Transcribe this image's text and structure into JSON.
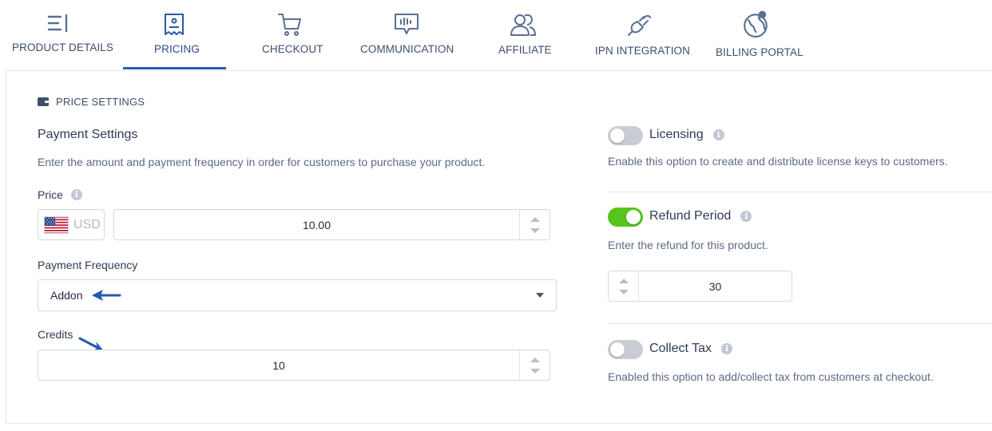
{
  "tabs": [
    {
      "label": "PRODUCT DETAILS",
      "icon": "list-icon"
    },
    {
      "label": "PRICING",
      "icon": "receipt-icon",
      "active": true
    },
    {
      "label": "CHECKOUT",
      "icon": "cart-icon"
    },
    {
      "label": "COMMUNICATION",
      "icon": "chat-icon"
    },
    {
      "label": "AFFILIATE",
      "icon": "users-icon"
    },
    {
      "label": "IPN INTEGRATION",
      "icon": "plug-icon"
    },
    {
      "label": "BILLING PORTAL",
      "icon": "globe-icon"
    }
  ],
  "section": {
    "title": "PRICE SETTINGS",
    "icon": "wallet-icon"
  },
  "payment": {
    "heading": "Payment Settings",
    "description": "Enter the amount and payment frequency in order for customers to purchase your product.",
    "price_label": "Price",
    "currency": "USD",
    "price_value": "10.00",
    "frequency_label": "Payment Frequency",
    "frequency_value": "Addon",
    "credits_label": "Credits",
    "credits_value": "10"
  },
  "licensing": {
    "label": "Licensing",
    "enabled": false,
    "description": "Enable this option to create and distribute license keys to customers."
  },
  "refund": {
    "label": "Refund Period",
    "enabled": true,
    "description": "Enter the refund for this product.",
    "value": "30"
  },
  "tax": {
    "label": "Collect Tax",
    "enabled": false,
    "description": "Enabled this option to add/collect tax from customers at checkout."
  },
  "colors": {
    "accent": "#2a5db0",
    "toggle_on": "#57c51b",
    "toggle_off": "#c9cdd3",
    "annotation_arrow": "#1f5bb5"
  }
}
